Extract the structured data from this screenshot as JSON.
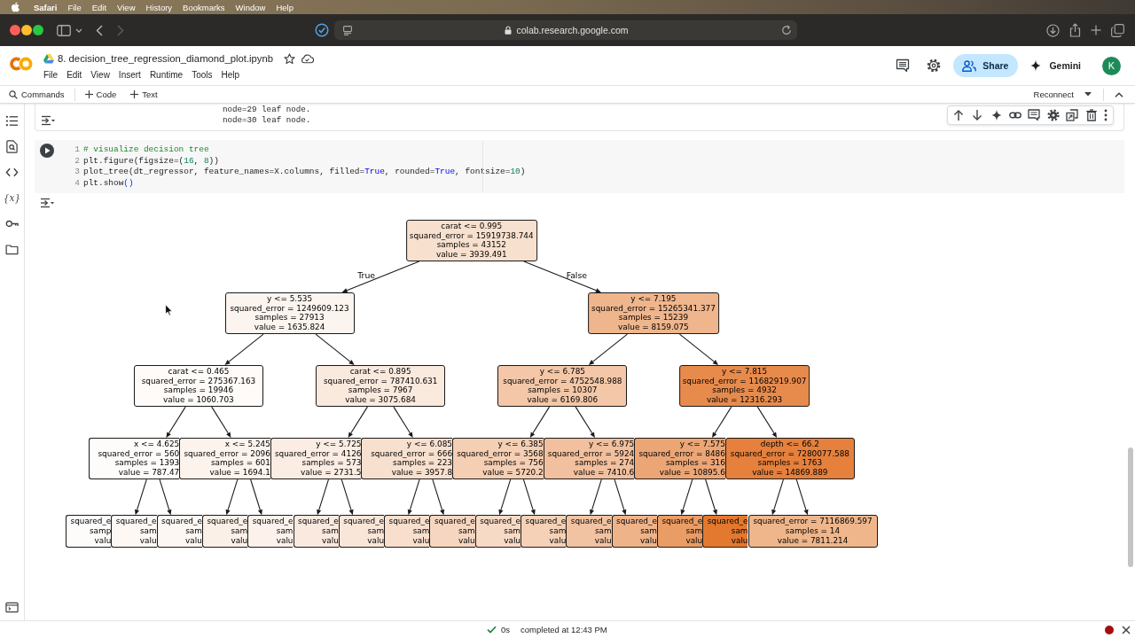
{
  "menubar": {
    "app": "Safari",
    "items": [
      "File",
      "Edit",
      "View",
      "History",
      "Bookmarks",
      "Window",
      "Help"
    ]
  },
  "browser": {
    "url": "colab.research.google.com"
  },
  "header": {
    "title": "8. decision_tree_regression_diamond_plot.ipynb",
    "menu": [
      "File",
      "Edit",
      "View",
      "Insert",
      "Runtime",
      "Tools",
      "Help"
    ],
    "share": "Share",
    "gemini": "Gemini",
    "avatar": "K"
  },
  "toolbar": {
    "commands": "Commands",
    "add_code": "Code",
    "add_text": "Text",
    "connect": "Reconnect"
  },
  "sidebar": {
    "variables": "{x}"
  },
  "cells": [
    {
      "kind": "output_text",
      "lines": [
        "node=29 leaf node.",
        "node=30 leaf node."
      ]
    },
    {
      "kind": "code",
      "lines": [
        {
          "number": "1",
          "tokens": [
            {
              "kind": "comment",
              "text": "# visualize decision tree"
            }
          ]
        },
        {
          "number": "2",
          "tokens": [
            {
              "kind": "plain",
              "text": "plt.figure(figsize=("
            },
            {
              "kind": "number",
              "text": "16"
            },
            {
              "kind": "plain",
              "text": ", "
            },
            {
              "kind": "number",
              "text": "8"
            },
            {
              "kind": "plain",
              "text": "))"
            }
          ]
        },
        {
          "number": "3",
          "tokens": [
            {
              "kind": "plain",
              "text": "plot_tree(dt_regressor, feature_names=X.columns, filled="
            },
            {
              "kind": "constant",
              "text": "True"
            },
            {
              "kind": "plain",
              "text": ", rounded="
            },
            {
              "kind": "constant",
              "text": "True"
            },
            {
              "kind": "plain",
              "text": ", fontsize="
            },
            {
              "kind": "number",
              "text": "10"
            },
            {
              "kind": "plain",
              "text": ")"
            }
          ]
        },
        {
          "number": "4",
          "tokens": [
            {
              "kind": "plain",
              "text": "plt.show"
            },
            {
              "kind": "bracket",
              "text": "()"
            }
          ]
        }
      ]
    },
    {
      "kind": "output_tree",
      "tree": {
        "lines": [
          "carat <= 0.995",
          "squared_error = 15919738.744",
          "samples = 43152",
          "value = 3939.491"
        ],
        "color": "#f8e0ce",
        "children": [
          {
            "edge_label": "True",
            "lines": [
              "y <= 5.535",
              "squared_error = 1249609.123",
              "samples = 27913",
              "value = 1635.824"
            ],
            "color": "#fcf5ef",
            "children": [
              {
                "lines": [
                  "carat <= 0.465",
                  "squared_error = 275367.163",
                  "samples = 19946",
                  "value = 1060.703"
                ],
                "color": "#fefbf8",
                "children": [
                  {
                    "lines": [
                      "x <= 4.625",
                      "squared_error = 560",
                      "samples = 1393",
                      "value = 787.47"
                    ],
                    "color": "#fefcfa",
                    "children": [
                      {
                        "lines": [
                          "squared_e",
                          "samp",
                          "valu"
                        ],
                        "color": "#fefcfb"
                      },
                      {
                        "lines": [
                          "squared_e",
                          "sam",
                          "valu"
                        ],
                        "color": "#fdf8f4"
                      }
                    ]
                  },
                  {
                    "lines": [
                      "x <= 5.245",
                      "squared_error = 2096",
                      "samples = 601",
                      "value = 1694.1"
                    ],
                    "color": "#fcf3ed",
                    "children": [
                      {
                        "lines": [
                          "squared_e",
                          "sam",
                          "valu"
                        ],
                        "color": "#fdf7f3"
                      },
                      {
                        "lines": [
                          "squared_e",
                          "sam",
                          "valu"
                        ],
                        "color": "#fbf0e8"
                      }
                    ]
                  }
                ]
              },
              {
                "lines": [
                  "carat <= 0.895",
                  "squared_error = 787410.631",
                  "samples = 7967",
                  "value = 3075.684"
                ],
                "color": "#fae9dd",
                "children": [
                  {
                    "lines": [
                      "y <= 5.725",
                      "squared_error = 4126",
                      "samples = 573",
                      "value = 2731.5"
                    ],
                    "color": "#fbede3",
                    "children": [
                      {
                        "lines": [
                          "squared_e",
                          "sam",
                          "valu"
                        ],
                        "color": "#fcf2eb"
                      },
                      {
                        "lines": [
                          "squared_e",
                          "sam",
                          "valu"
                        ],
                        "color": "#fae9de"
                      }
                    ]
                  },
                  {
                    "lines": [
                      "y <= 6.085",
                      "squared_error = 666",
                      "samples = 223",
                      "value = 3957.8"
                    ],
                    "color": "#f8e0cf",
                    "children": [
                      {
                        "lines": [
                          "squared_e",
                          "sam",
                          "valu"
                        ],
                        "color": "#f9e6d9"
                      },
                      {
                        "lines": [
                          "squared_e",
                          "sam",
                          "valu"
                        ],
                        "color": "#f8dfcd"
                      }
                    ]
                  }
                ]
              }
            ]
          },
          {
            "edge_label": "False",
            "lines": [
              "y <= 7.195",
              "squared_error = 15265341.377",
              "samples = 15239",
              "value = 8159.075"
            ],
            "color": "#efb68d",
            "children": [
              {
                "lines": [
                  "y <= 6.785",
                  "squared_error = 4752548.988",
                  "samples = 10307",
                  "value = 6169.806"
                ],
                "color": "#f3c7a7",
                "children": [
                  {
                    "lines": [
                      "y <= 6.385",
                      "squared_error = 3568",
                      "samples = 756",
                      "value = 5720.2"
                    ],
                    "color": "#f5cfb4",
                    "children": [
                      {
                        "lines": [
                          "squared_e",
                          "sam",
                          "valu"
                        ],
                        "color": "#f6d6c0"
                      },
                      {
                        "lines": [
                          "squared_e",
                          "sam",
                          "valu"
                        ],
                        "color": "#f7dac6"
                      }
                    ]
                  },
                  {
                    "lines": [
                      "y <= 6.975",
                      "squared_error = 5924",
                      "samples = 274",
                      "value = 7410.6"
                    ],
                    "color": "#f2c09e",
                    "children": [
                      {
                        "lines": [
                          "squared_e",
                          "sam",
                          "valu"
                        ],
                        "color": "#f5d1b7"
                      },
                      {
                        "lines": [
                          "squared_e",
                          "sam",
                          "valu"
                        ],
                        "color": "#f2c3a2"
                      }
                    ]
                  }
                ]
              },
              {
                "lines": [
                  "y <= 7.815",
                  "squared_error = 11682919.907",
                  "samples = 4932",
                  "value = 12316.293"
                ],
                "color": "#e78b4d",
                "children": [
                  {
                    "lines": [
                      "y <= 7.575",
                      "squared_error = 8486",
                      "samples = 316",
                      "value = 10895.6"
                    ],
                    "color": "#eca676",
                    "children": [
                      {
                        "lines": [
                          "squared_e",
                          "sam",
                          "valu"
                        ],
                        "color": "#efb38a"
                      },
                      {
                        "lines": [
                          "squared_e",
                          "sam",
                          "valu"
                        ],
                        "color": "#ea9c65"
                      }
                    ]
                  },
                  {
                    "lines": [
                      "depth <= 66.2",
                      "squared_error = 7280077.588",
                      "samples = 1763",
                      "value = 14869.889"
                    ],
                    "color": "#e5803d",
                    "children": [
                      {
                        "lines": [
                          "squared_e",
                          "sam",
                          "valu"
                        ],
                        "color": "#e3782f"
                      },
                      {
                        "lines": [
                          "squared_error = 7116869.597",
                          "samples = 14",
                          "value = 7811.214"
                        ],
                        "color": "#efb68c"
                      }
                    ]
                  }
                ]
              }
            ]
          }
        ]
      }
    }
  ],
  "status_bar": {
    "duration": "0s",
    "message": "completed at 12:43 PM"
  }
}
